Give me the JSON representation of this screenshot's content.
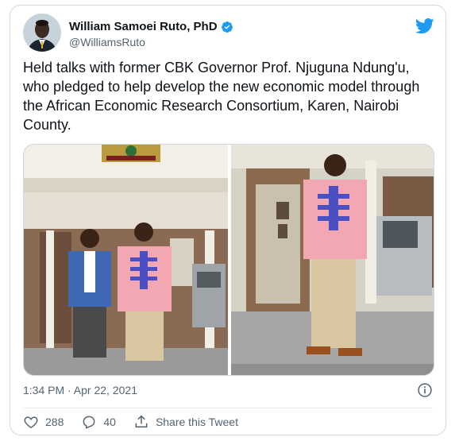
{
  "author": {
    "name": "William Samoei Ruto, PhD",
    "handle": "@WilliamsRuto"
  },
  "tweet": {
    "text": "Held talks with former CBK Governor Prof. Njuguna Ndung'u, who pledged to help develop the new economic model through the African Economic Research Consortium, Karen, Nairobi County.",
    "timestamp": "1:34 PM · Apr 22, 2021"
  },
  "actions": {
    "likes": "288",
    "replies": "40",
    "share_label": "Share this Tweet"
  },
  "colors": {
    "twitter_blue": "#1d9bf0",
    "text_secondary": "#536471",
    "border": "#cfd9de"
  },
  "icons": [
    "twitter-bird-icon",
    "verified-badge-icon",
    "info-icon",
    "heart-icon",
    "reply-icon",
    "share-icon"
  ]
}
